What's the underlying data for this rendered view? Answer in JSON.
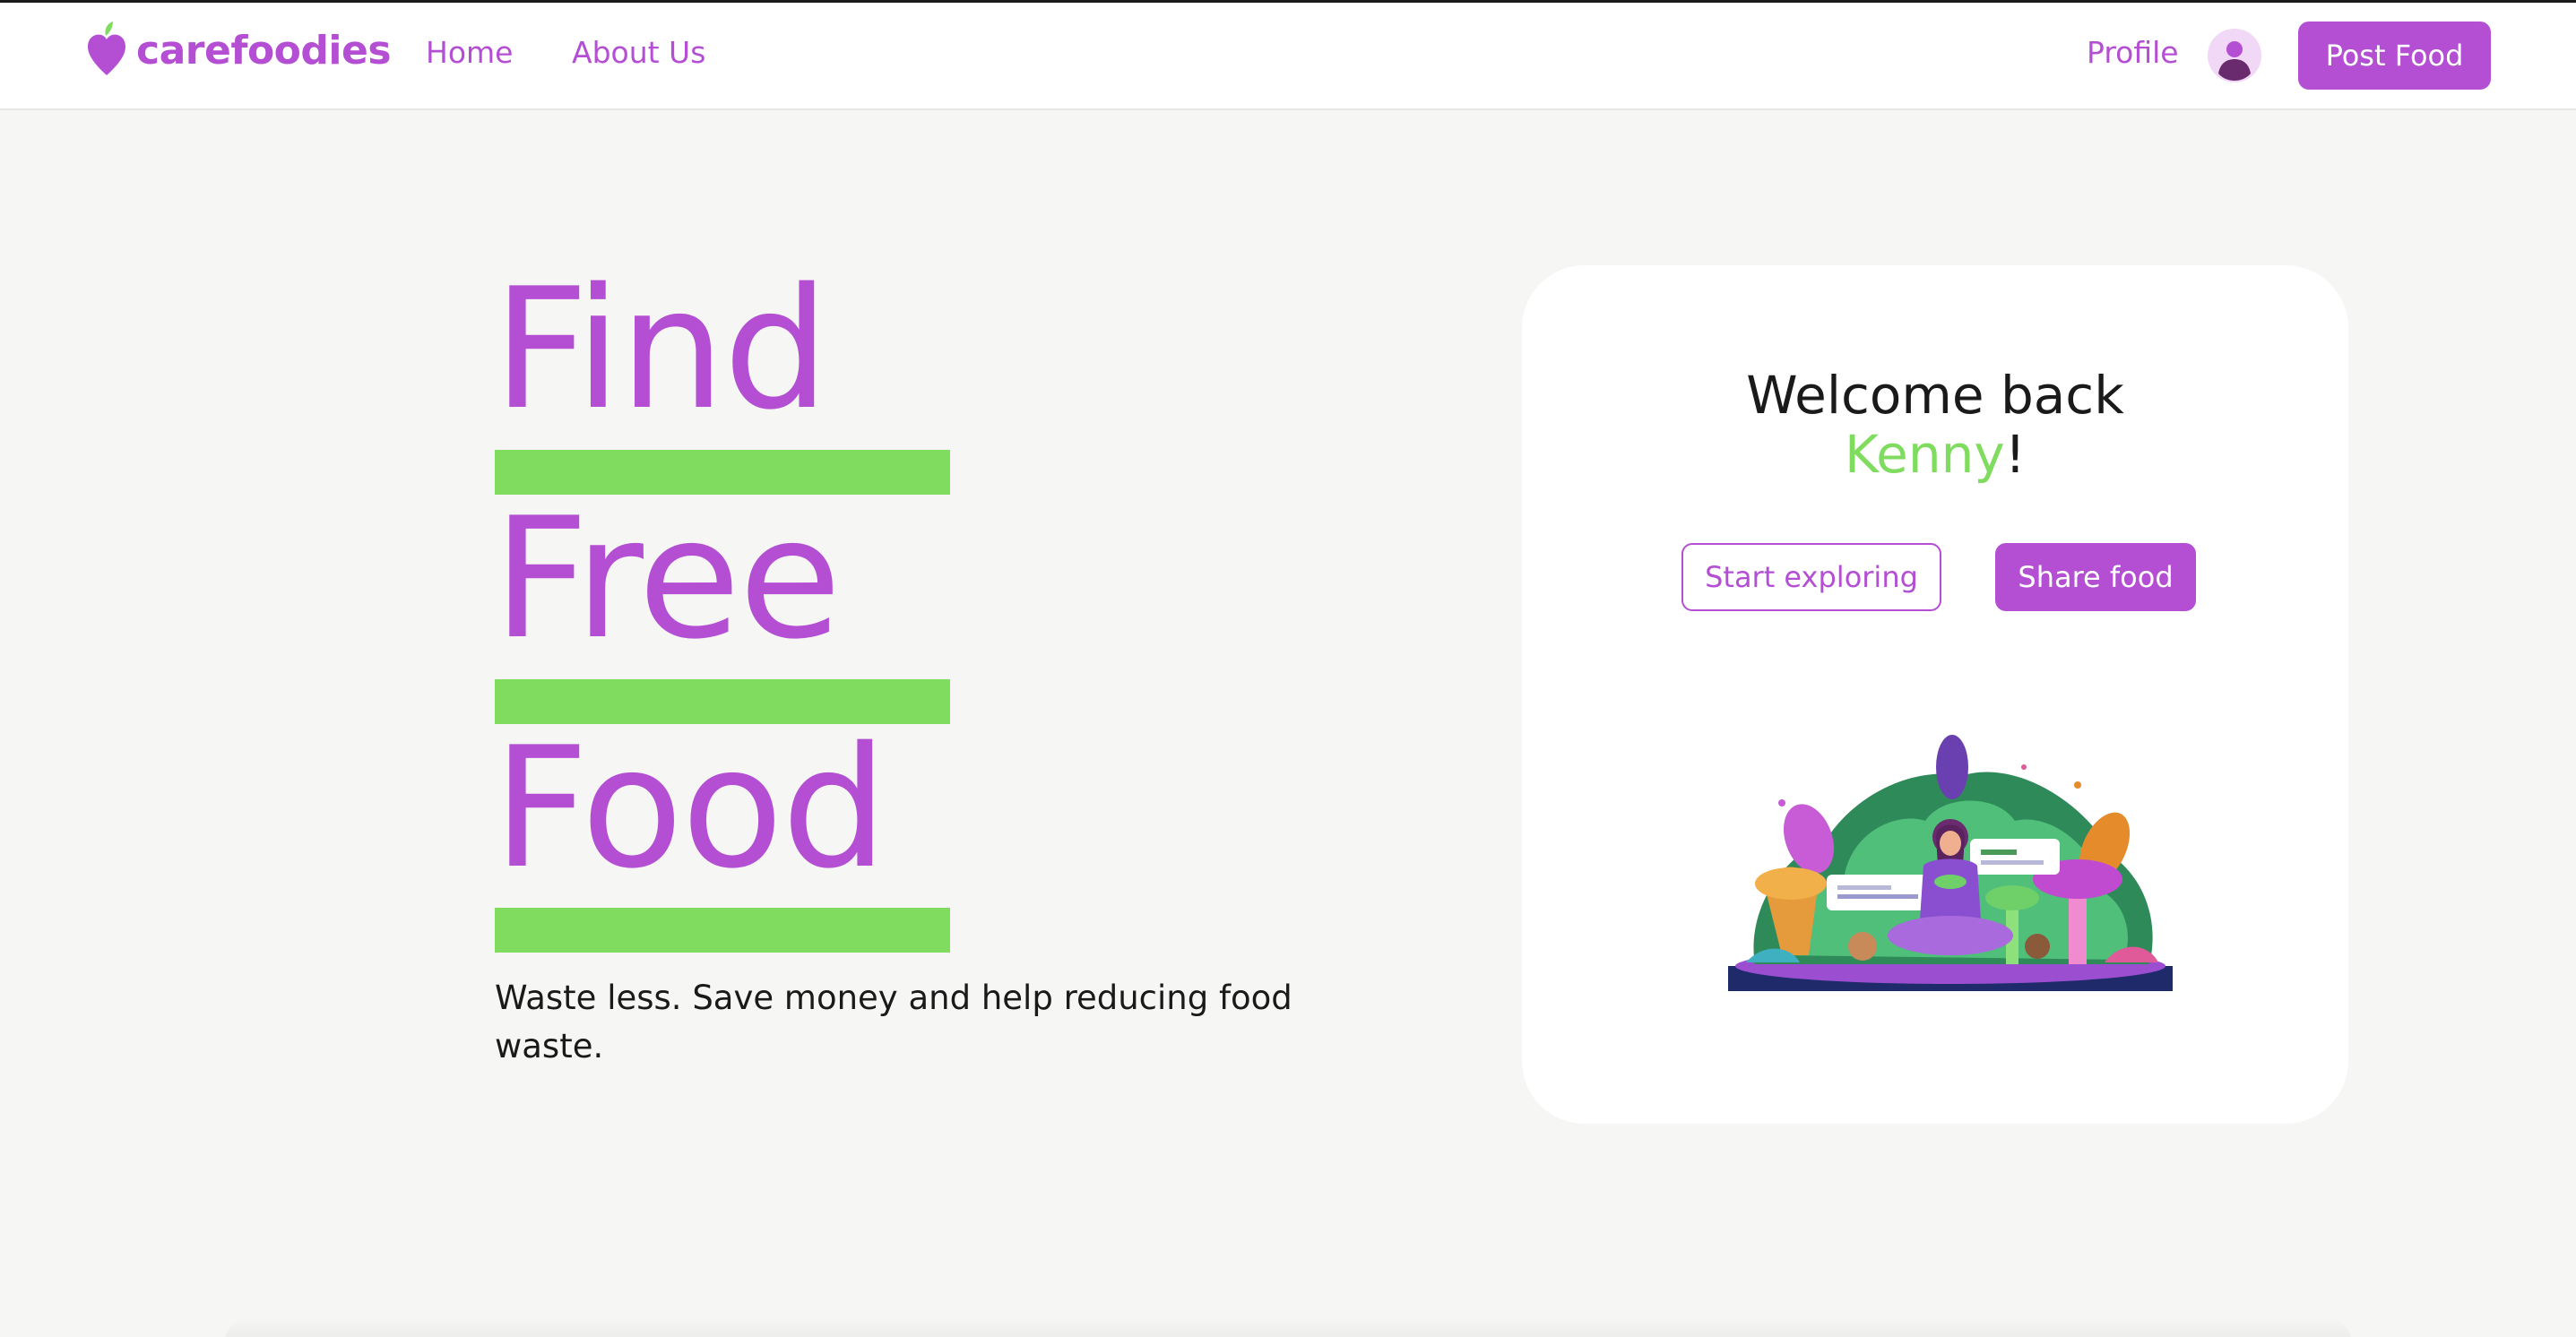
{
  "brand": {
    "name": "carefoodies",
    "color": "#b44fd4",
    "accent": "#7fdc5f"
  },
  "nav": {
    "home": "Home",
    "about": "About Us",
    "profile": "Profile",
    "post_food": "Post Food",
    "logo_icon": "apple-heart-icon",
    "avatar_icon": "user-avatar-icon"
  },
  "hero": {
    "word1": "Find",
    "word2": "Free",
    "word3": "Food",
    "tagline": "Waste less. Save money and help reducing food waste."
  },
  "card": {
    "welcome_prefix": "Welcome back",
    "user_name": "Kenny",
    "punctuation": "!",
    "explore_button": "Start exploring",
    "share_button": "Share food",
    "illustration_icon": "jungle-illustration"
  }
}
